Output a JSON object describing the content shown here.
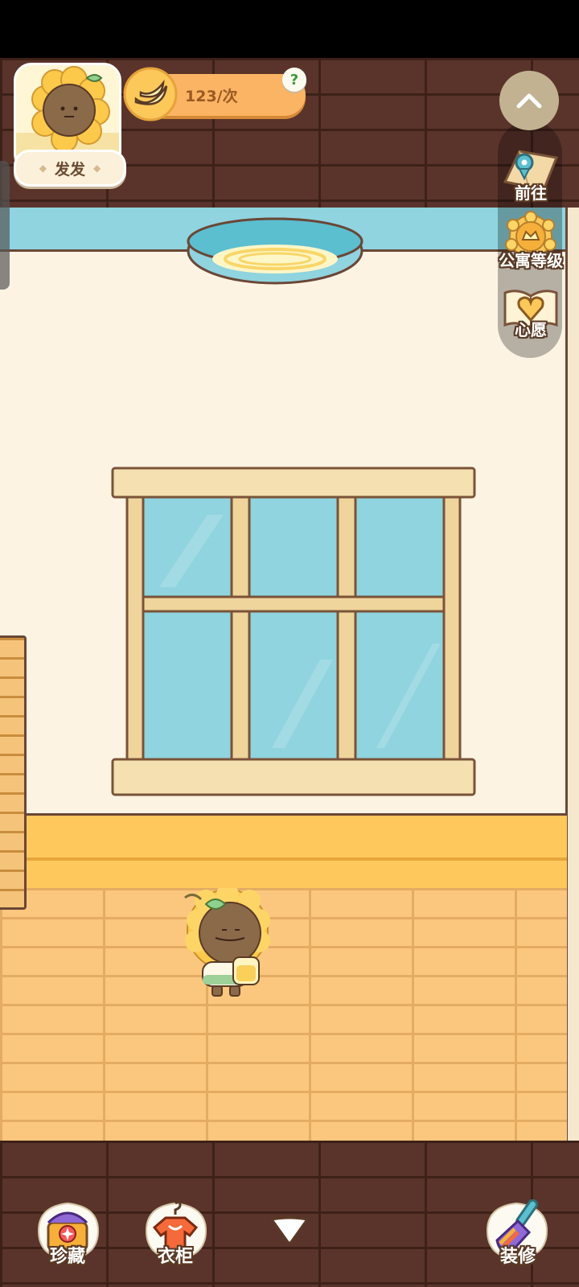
{
  "player": {
    "name": "发发"
  },
  "currency": {
    "value": "123/次",
    "icon": "banana-icon"
  },
  "right_menu": {
    "collapse_icon": "chevron-up-icon",
    "items": [
      {
        "label": "前往",
        "icon": "map-pin-icon"
      },
      {
        "label": "公寓等级",
        "icon": "sun-badge-icon"
      },
      {
        "label": "心愿",
        "icon": "heart-book-icon"
      }
    ]
  },
  "bottom_bar": {
    "collection_label": "珍藏",
    "wardrobe_label": "衣柜",
    "expand_icon": "triangle-down-icon",
    "decorate_label": "装修"
  },
  "help_icon": "?",
  "colors": {
    "brick": "#5a342a",
    "wall": "#fdf3e3",
    "floor": "#fbc77e",
    "wainscot": "#fec85c",
    "window_glass": "#8fd4df"
  }
}
